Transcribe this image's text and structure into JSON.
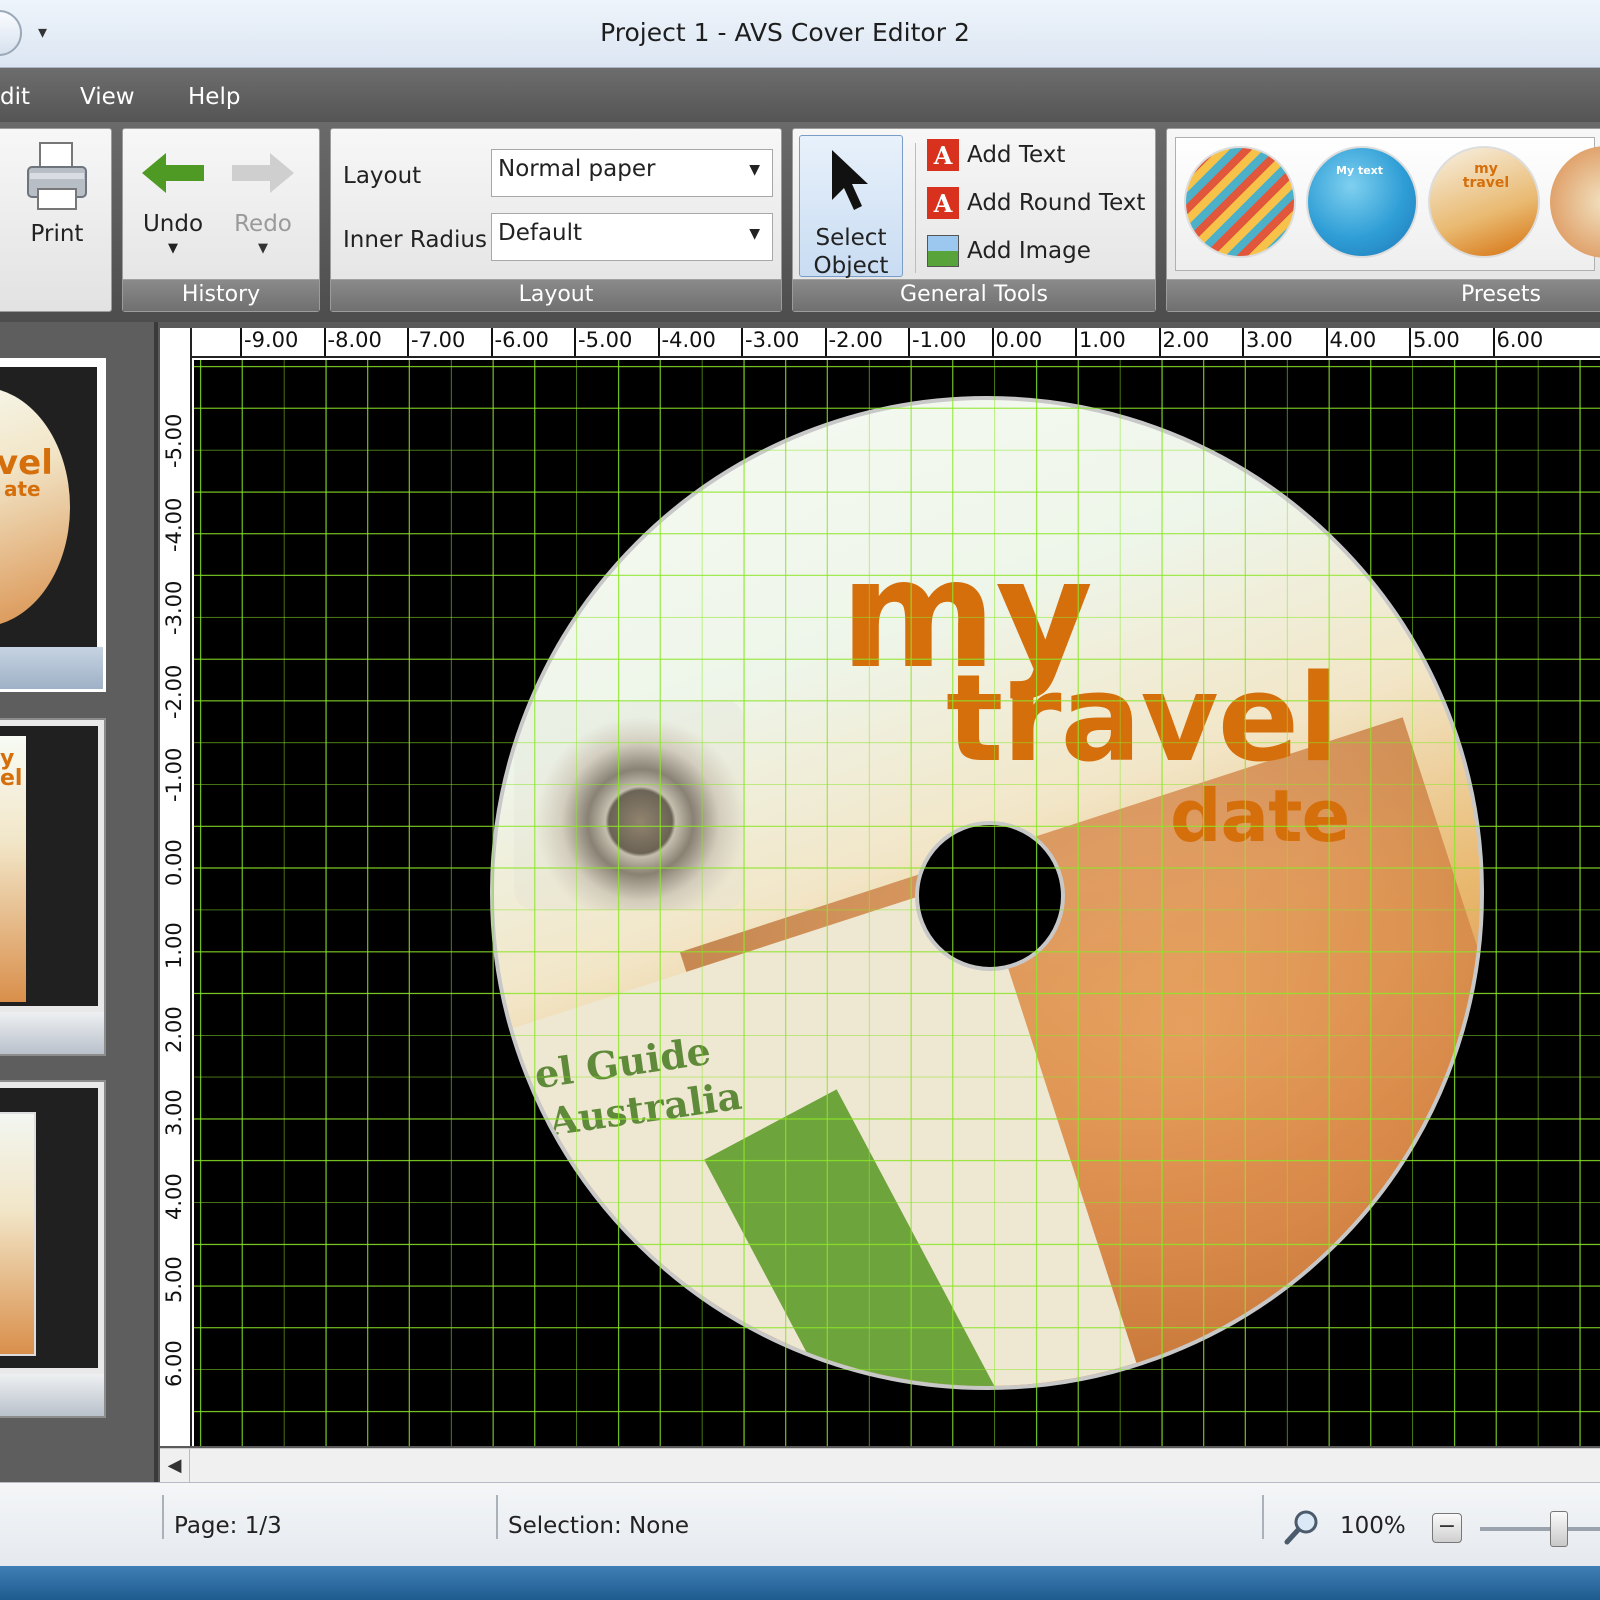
{
  "window": {
    "title": "Project 1 - AVS Cover Editor 2",
    "quick_access_arrow": "▾"
  },
  "menu": {
    "items": [
      "dit",
      "View",
      "Help"
    ]
  },
  "ribbon": {
    "print_label": "Print",
    "history": {
      "label": "History",
      "undo_label": "Undo",
      "redo_label": "Redo"
    },
    "layout": {
      "label": "Layout",
      "layout_field_label": "Layout",
      "layout_value": "Normal paper",
      "inner_radius_label": "Inner Radius",
      "inner_radius_value": "Default"
    },
    "general_tools": {
      "label": "General Tools",
      "select_object_line1": "Select",
      "select_object_line2": "Object",
      "add_text": "Add Text",
      "add_round_text": "Add Round Text",
      "add_image": "Add Image"
    },
    "presets": {
      "label": "Presets",
      "items": [
        {
          "title": "",
          "colors": [
            "#f6c24a",
            "#4bb0c8",
            "#e1573c"
          ]
        },
        {
          "title": "My text",
          "colors": [
            "#2f9ed6",
            "#7fd0ef",
            "#1d76b5"
          ]
        },
        {
          "title": "my travel",
          "colors": [
            "#f7f1e3",
            "#e9b970",
            "#d56f0c"
          ]
        }
      ]
    }
  },
  "rulers": {
    "horizontal": [
      "-9.00",
      "-8.00",
      "-7.00",
      "-6.00",
      "-5.00",
      "-4.00",
      "-3.00",
      "-2.00",
      "-1.00",
      "0.00",
      "1.00",
      "2.00",
      "3.00",
      "4.00",
      "5.00",
      "6.00"
    ],
    "vertical": [
      "-5.00",
      "-4.00",
      "-3.00",
      "-2.00",
      "-1.00",
      "0.00",
      "1.00",
      "2.00",
      "3.00",
      "4.00",
      "5.00",
      "6.00"
    ]
  },
  "disc": {
    "line1": "my",
    "line2": "travel",
    "line3": "date",
    "guide_line1": "el Guide",
    "guide_line2": "Australia"
  },
  "thumbnails": [
    {
      "text_a": "vel",
      "text_b": "ate",
      "selected": true
    },
    {
      "text_a": "y",
      "text_b": "el",
      "selected": false
    },
    {
      "text_a": "",
      "text_b": "",
      "selected": false
    }
  ],
  "status": {
    "page": "Page: 1/3",
    "selection": "Selection: None",
    "zoom": "100%",
    "zoom_minus": "−"
  },
  "colors": {
    "accent_text": "#d56f0c",
    "grid": "#8ce628",
    "ribbon": "#5a5a5a"
  }
}
